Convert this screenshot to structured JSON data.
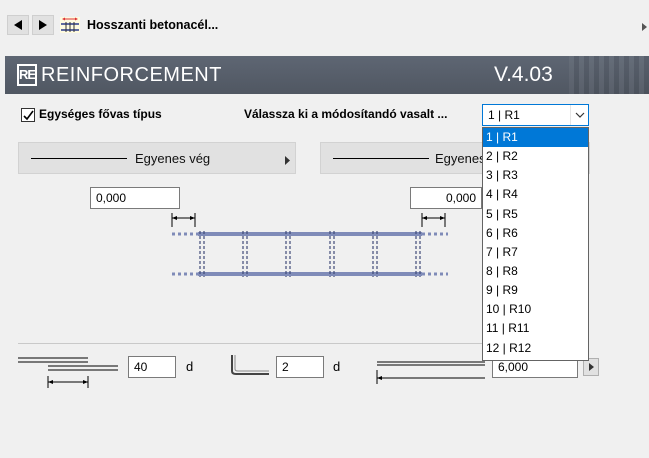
{
  "nav": {
    "back_icon": "triangle-left-icon",
    "forward_icon": "triangle-right-icon",
    "breadcrumb_icon": "rebar-cage-icon",
    "breadcrumb_label": "Hosszanti betonacél..."
  },
  "header": {
    "logo_text": "RE",
    "title": "REINFORCEMENT",
    "version": "V.4.03",
    "bg_color": "#575e69"
  },
  "form": {
    "uniform_checkbox_label": "Egységes fővas típus",
    "uniform_checked": true,
    "select_label": "Válassza ki a módosítandó vasalt ...",
    "select_value": "1 | R1",
    "select_options": [
      "1 | R1",
      "2 | R2",
      "3 | R3",
      "4 | R4",
      "5 | R5",
      "6 | R6",
      "7 | R7",
      "8 | R8",
      "9 | R9",
      "10 | R10",
      "11 | R11",
      "12 | R12"
    ],
    "selected_index": 0,
    "accent_color": "#0078d7"
  },
  "ends": {
    "left_label": "Egyenes vég",
    "right_label": "Egyenes",
    "left_value": "0,000",
    "right_value": "0,000"
  },
  "bottom": {
    "lap_value": "40",
    "lap_unit": "d",
    "hook_value": "2",
    "hook_unit": "d",
    "length_value": "6,000"
  }
}
